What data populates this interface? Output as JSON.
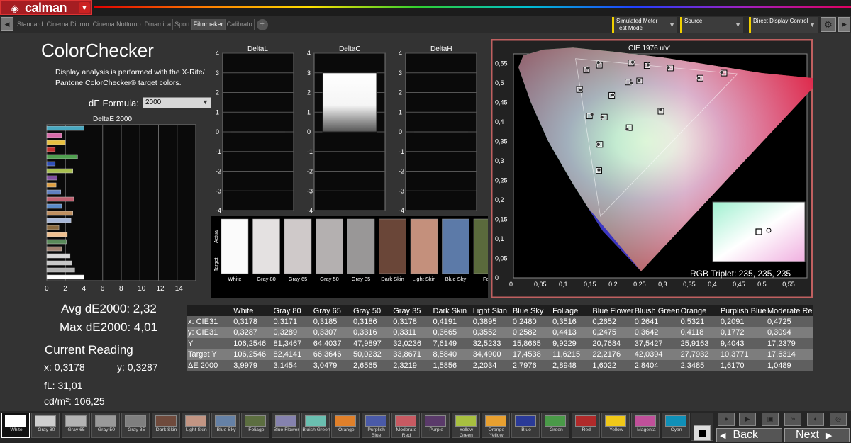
{
  "app": {
    "logo_text": "calman",
    "logo_mark": "◈"
  },
  "tabs": [
    "Standard",
    "Cinema Diurno",
    "Cinema Notturno",
    "Dinamica",
    "Sport",
    "Filmmaker",
    "Calibrato"
  ],
  "active_tab": 5,
  "toolbar": {
    "meter": {
      "line1": "Simulated Meter",
      "line2": "Test Mode"
    },
    "source": {
      "line1": "Source"
    },
    "display": {
      "line1": "Direct Display Control"
    }
  },
  "page": {
    "title": "ColorChecker",
    "description": "Display analysis is performed with the X-Rite/ Pantone ColorChecker® target colors.",
    "formula_label": "dE Formula:",
    "formula_value": "2000"
  },
  "stats": {
    "avg": "Avg dE2000: 2,32",
    "max": "Max dE2000: 4,01",
    "current_title": "Current Reading",
    "x": "x: 0,3178",
    "y": "y: 0,3287",
    "fl": "fL: 31,01",
    "cdm": "cd/m²: 106,25"
  },
  "chart_data": [
    {
      "type": "bar",
      "title": "DeltaE 2000",
      "orientation": "horizontal",
      "xlim": [
        0,
        16
      ],
      "xticks": [
        0,
        2,
        4,
        6,
        8,
        10,
        12,
        14
      ],
      "values": [
        4.0,
        1.6,
        2.0,
        0.9,
        3.3,
        0.9,
        2.8,
        1.1,
        1.0,
        1.5,
        2.9,
        1.6,
        2.8,
        2.6,
        1.3,
        2.2,
        2.1,
        1.6,
        2.5,
        2.7,
        3.0,
        4.0
      ],
      "bar_colors": [
        "#4aa8c0",
        "#d86aa8",
        "#e8c040",
        "#c03030",
        "#50a050",
        "#3050b8",
        "#a8c050",
        "#8050a0",
        "#e0a040",
        "#6080c0",
        "#c06070",
        "#5a8ac8",
        "#c09060",
        "#a8b8d8",
        "#8a6a40",
        "#f0c090",
        "#5a8a5a",
        "#a08070",
        "#d8d8d8",
        "#c8c8c8",
        "#b0b0b0",
        "#ffffff"
      ]
    },
    {
      "type": "bar",
      "title": "DeltaL",
      "ylim": [
        -4,
        4
      ],
      "yticks": [
        4,
        3,
        2,
        1,
        0,
        -1,
        -2,
        -3,
        -4
      ],
      "value": 0
    },
    {
      "type": "bar",
      "title": "DeltaC",
      "ylim": [
        -4,
        4
      ],
      "yticks": [
        4,
        3,
        2,
        1,
        0,
        -1,
        -2,
        -3,
        -4
      ],
      "value": 3.0
    },
    {
      "type": "bar",
      "title": "DeltaH",
      "ylim": [
        -4,
        4
      ],
      "yticks": [
        4,
        3,
        2,
        1,
        0,
        -1,
        -2,
        -3,
        -4
      ],
      "value": 0
    },
    {
      "type": "scatter",
      "title": "CIE 1976 u'v'",
      "xlim": [
        0,
        0.6
      ],
      "ylim": [
        0,
        0.6
      ],
      "xticks": [
        "0",
        "0,05",
        "0,1",
        "0,15",
        "0,2",
        "0,25",
        "0,3",
        "0,35",
        "0,4",
        "0,45",
        "0,5",
        "0,55"
      ],
      "yticks": [
        "0,55",
        "0,5",
        "0,45",
        "0,4",
        "0,35",
        "0,3",
        "0,25",
        "0,2",
        "0,15",
        "0,1",
        "0,05",
        "0"
      ],
      "targets": [
        [
          0.198,
          0.468
        ],
        [
          0.147,
          0.533
        ],
        [
          0.173,
          0.545
        ],
        [
          0.237,
          0.551
        ],
        [
          0.269,
          0.544
        ],
        [
          0.316,
          0.538
        ],
        [
          0.376,
          0.512
        ],
        [
          0.424,
          0.525
        ],
        [
          0.133,
          0.483
        ],
        [
          0.231,
          0.502
        ],
        [
          0.254,
          0.505
        ],
        [
          0.183,
          0.412
        ],
        [
          0.153,
          0.415
        ],
        [
          0.297,
          0.427
        ],
        [
          0.174,
          0.342
        ],
        [
          0.233,
          0.385
        ],
        [
          0.172,
          0.275
        ]
      ],
      "measured": [
        [
          0.2,
          0.469
        ],
        [
          0.149,
          0.537
        ],
        [
          0.171,
          0.552
        ],
        [
          0.24,
          0.553
        ],
        [
          0.271,
          0.546
        ],
        [
          0.312,
          0.539
        ],
        [
          0.373,
          0.512
        ],
        [
          0.419,
          0.527
        ],
        [
          0.135,
          0.481
        ],
        [
          0.237,
          0.499
        ],
        [
          0.253,
          0.507
        ],
        [
          0.178,
          0.412
        ],
        [
          0.158,
          0.419
        ],
        [
          0.296,
          0.432
        ],
        [
          0.171,
          0.342
        ],
        [
          0.229,
          0.381
        ],
        [
          0.172,
          0.277
        ]
      ],
      "inset_label": "RGB Triplet: 235, 235, 235"
    }
  ],
  "swatches": {
    "actual_label": "Actual",
    "target_label": "Target",
    "items": [
      {
        "name": "White",
        "color": "#fbfbfb"
      },
      {
        "name": "Gray 80",
        "color": "#e4e1e1"
      },
      {
        "name": "Gray 65",
        "color": "#cfc9c9"
      },
      {
        "name": "Gray 50",
        "color": "#b4b0b0"
      },
      {
        "name": "Gray 35",
        "color": "#999797"
      },
      {
        "name": "Dark Skin",
        "color": "#6a4638"
      },
      {
        "name": "Light Skin",
        "color": "#c4907c"
      },
      {
        "name": "Blue Sky",
        "color": "#5c7aa8"
      },
      {
        "name": "Foli",
        "color": "#5a6a3c"
      }
    ]
  },
  "table": {
    "headers": [
      "",
      "White",
      "Gray 80",
      "Gray 65",
      "Gray 50",
      "Gray 35",
      "Dark Skin",
      "Light Skin",
      "Blue Sky",
      "Foliage",
      "Blue Flower",
      "Bluish Green",
      "Orange",
      "Purplish Blue",
      "Moderate Re"
    ],
    "rows": [
      [
        "x: CIE31",
        "0,3178",
        "0,3171",
        "0,3185",
        "0,3186",
        "0,3178",
        "0,4191",
        "0,3895",
        "0,2480",
        "0,3516",
        "0,2652",
        "0,2641",
        "0,5321",
        "0,2091",
        "0,4725"
      ],
      [
        "y: CIE31",
        "0,3287",
        "0,3289",
        "0,3307",
        "0,3316",
        "0,3311",
        "0,3665",
        "0,3552",
        "0,2582",
        "0,4413",
        "0,2475",
        "0,3642",
        "0,4118",
        "0,1772",
        "0,3094"
      ],
      [
        "Y",
        "106,2546",
        "81,3467",
        "64,4037",
        "47,9897",
        "32,0236",
        "7,6149",
        "32,5233",
        "15,8665",
        "9,9229",
        "20,7684",
        "37,5427",
        "25,9163",
        "9,4043",
        "17,2379"
      ],
      [
        "Target Y",
        "106,2546",
        "82,4141",
        "66,3646",
        "50,0232",
        "33,8671",
        "8,5840",
        "34,4900",
        "17,4538",
        "11,6215",
        "22,2176",
        "42,0394",
        "27,7932",
        "10,3771",
        "17,6314"
      ],
      [
        "ΔE 2000",
        "3,9979",
        "3,1454",
        "3,0479",
        "2,6565",
        "2,3219",
        "1,5856",
        "2,2034",
        "2,7976",
        "2,8948",
        "1,6022",
        "2,8404",
        "2,3485",
        "1,6170",
        "1,0489"
      ]
    ]
  },
  "patches": [
    {
      "name": "White",
      "color": "#ffffff"
    },
    {
      "name": "Gray 80",
      "color": "#cfcfcf"
    },
    {
      "name": "Gray 65",
      "color": "#b4b4b4"
    },
    {
      "name": "Gray 50",
      "color": "#999999"
    },
    {
      "name": "Gray 35",
      "color": "#7f7f7f"
    },
    {
      "name": "Dark Skin",
      "color": "#6f4a3c"
    },
    {
      "name": "Light Skin",
      "color": "#c29583"
    },
    {
      "name": "Blue Sky",
      "color": "#6581a6"
    },
    {
      "name": "Foliage",
      "color": "#5c6e40"
    },
    {
      "name": "Blue Flower",
      "color": "#8582ae"
    },
    {
      "name": "Bluish Green",
      "color": "#6abfb0"
    },
    {
      "name": "Orange",
      "color": "#e0802a"
    },
    {
      "name": "Purplish Blue",
      "color": "#4a5aa8"
    },
    {
      "name": "Moderate Red",
      "color": "#c85a62"
    },
    {
      "name": "Purple",
      "color": "#5a3a6a"
    },
    {
      "name": "Yellow Green",
      "color": "#a8c040"
    },
    {
      "name": "Orange Yellow",
      "color": "#e8a030"
    },
    {
      "name": "Blue",
      "color": "#2a3a98"
    },
    {
      "name": "Green",
      "color": "#4a9a48"
    },
    {
      "name": "Red",
      "color": "#b02a2a"
    },
    {
      "name": "Yellow",
      "color": "#f0c818"
    },
    {
      "name": "Magenta",
      "color": "#c0509a"
    },
    {
      "name": "Cyan",
      "color": "#1090b8"
    }
  ],
  "nav": {
    "back": "Back",
    "next": "Next"
  },
  "colors": {
    "accent": "#a51d22",
    "cie_frame": "#c06060",
    "toolbar_marker": "#f0d000"
  }
}
